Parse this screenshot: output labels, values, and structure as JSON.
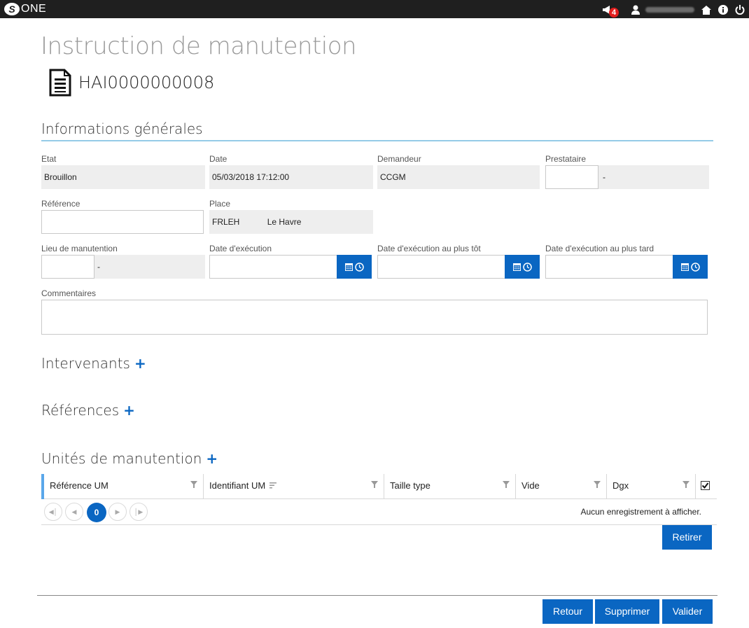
{
  "app": {
    "logo_mark": "S",
    "logo_text": "ONE"
  },
  "topbar": {
    "notification_count": "4",
    "icons": [
      "megaphone-icon",
      "user-icon",
      "home-icon",
      "info-icon",
      "power-icon"
    ]
  },
  "page": {
    "title": "Instruction de manutention",
    "doc_id": "HAI0000000008"
  },
  "general": {
    "title": "Informations générales",
    "etat": {
      "label": "Etat",
      "value": "Brouillon"
    },
    "date": {
      "label": "Date",
      "value": "05/03/2018 17:12:00"
    },
    "demandeur": {
      "label": "Demandeur",
      "value": "CCGM"
    },
    "prestataire": {
      "label": "Prestataire",
      "code": "",
      "desc": "-"
    },
    "reference": {
      "label": "Référence",
      "value": ""
    },
    "place": {
      "label": "Place",
      "code": "FRLEH",
      "name": "Le Havre"
    },
    "lieu": {
      "label": "Lieu de manutention",
      "code": "",
      "desc": "-"
    },
    "date_exec": {
      "label": "Date d'exécution",
      "value": ""
    },
    "date_tot": {
      "label": "Date d'exécution au plus tôt",
      "value": ""
    },
    "date_tard": {
      "label": "Date d'exécution au plus tard",
      "value": ""
    },
    "commentaires": {
      "label": "Commentaires",
      "value": ""
    }
  },
  "sections": {
    "intervenants": "Intervenants",
    "references": "Références",
    "unites": "Unités de manutention",
    "plus": "+"
  },
  "grid": {
    "columns": [
      "Référence UM",
      "Identifiant UM",
      "Taille type",
      "Vide",
      "Dgx"
    ],
    "current_page": "0",
    "empty_message": "Aucun enregistrement à afficher.",
    "select_all_checked": true
  },
  "buttons": {
    "retirer": "Retirer",
    "retour": "Retour",
    "supprimer": "Supprimer",
    "valider": "Valider"
  },
  "colors": {
    "accent": "#0a66c2",
    "topbar": "#1f1f1f",
    "section_rule": "#95cbe7",
    "badge": "#e11d1d"
  }
}
